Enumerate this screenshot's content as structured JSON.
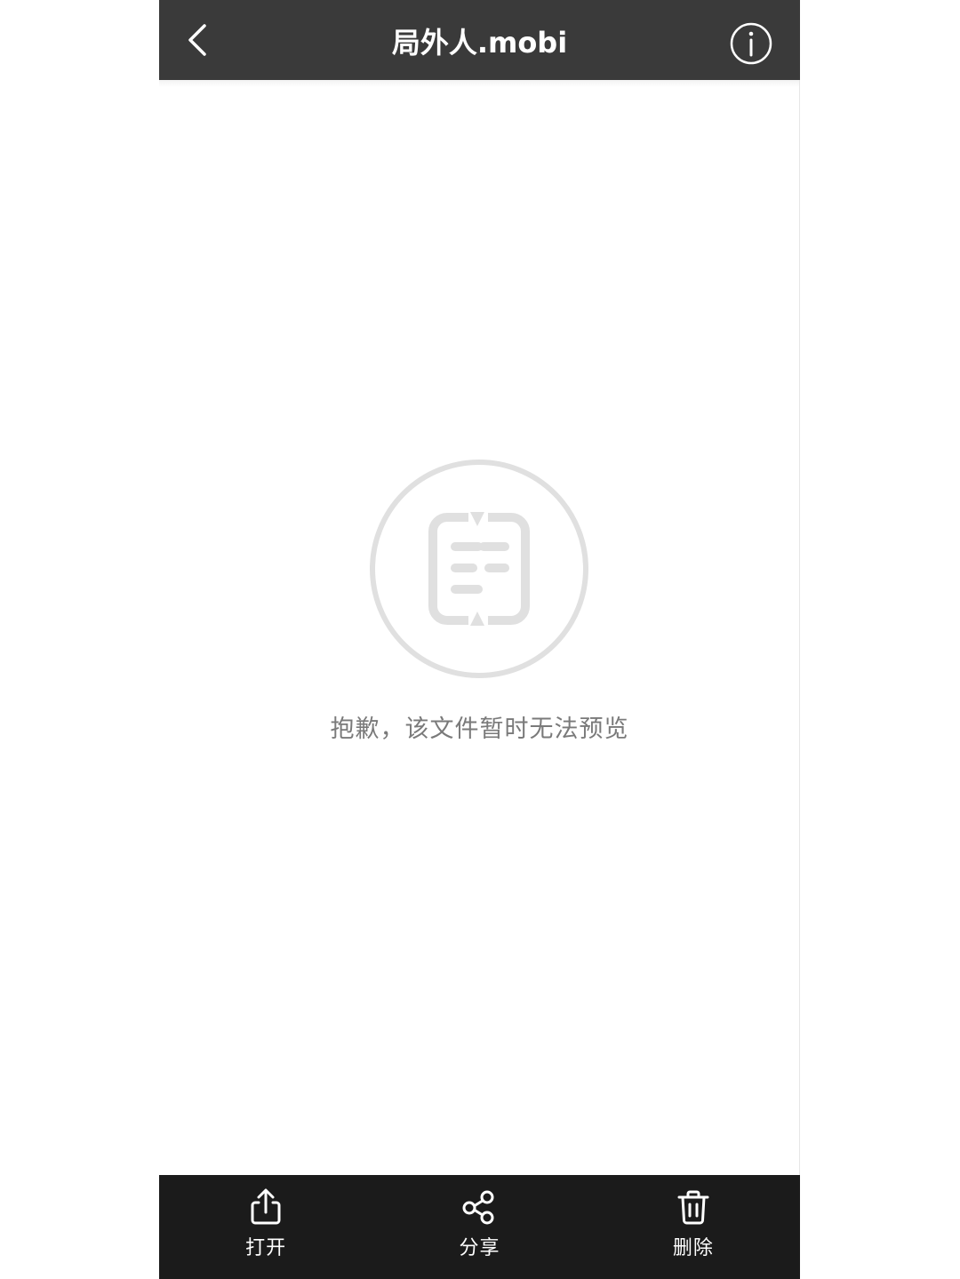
{
  "navbar": {
    "title": "局外人.mobi",
    "back_icon": "chevron-left-icon",
    "info_icon": "info-circle-icon"
  },
  "preview": {
    "icon": "document-placeholder-icon",
    "message": "抱歉，该文件暂时无法预览"
  },
  "toolbar": {
    "items": [
      {
        "label": "打开",
        "icon": "share-export-icon"
      },
      {
        "label": "分享",
        "icon": "share-nodes-icon"
      },
      {
        "label": "删除",
        "icon": "trash-icon"
      }
    ]
  },
  "colors": {
    "navbar_bg": "#3a3a3a",
    "toolbar_bg": "#1b1b1b",
    "placeholder_gray": "#e0e0e0",
    "message_text": "#7a7a7a"
  }
}
